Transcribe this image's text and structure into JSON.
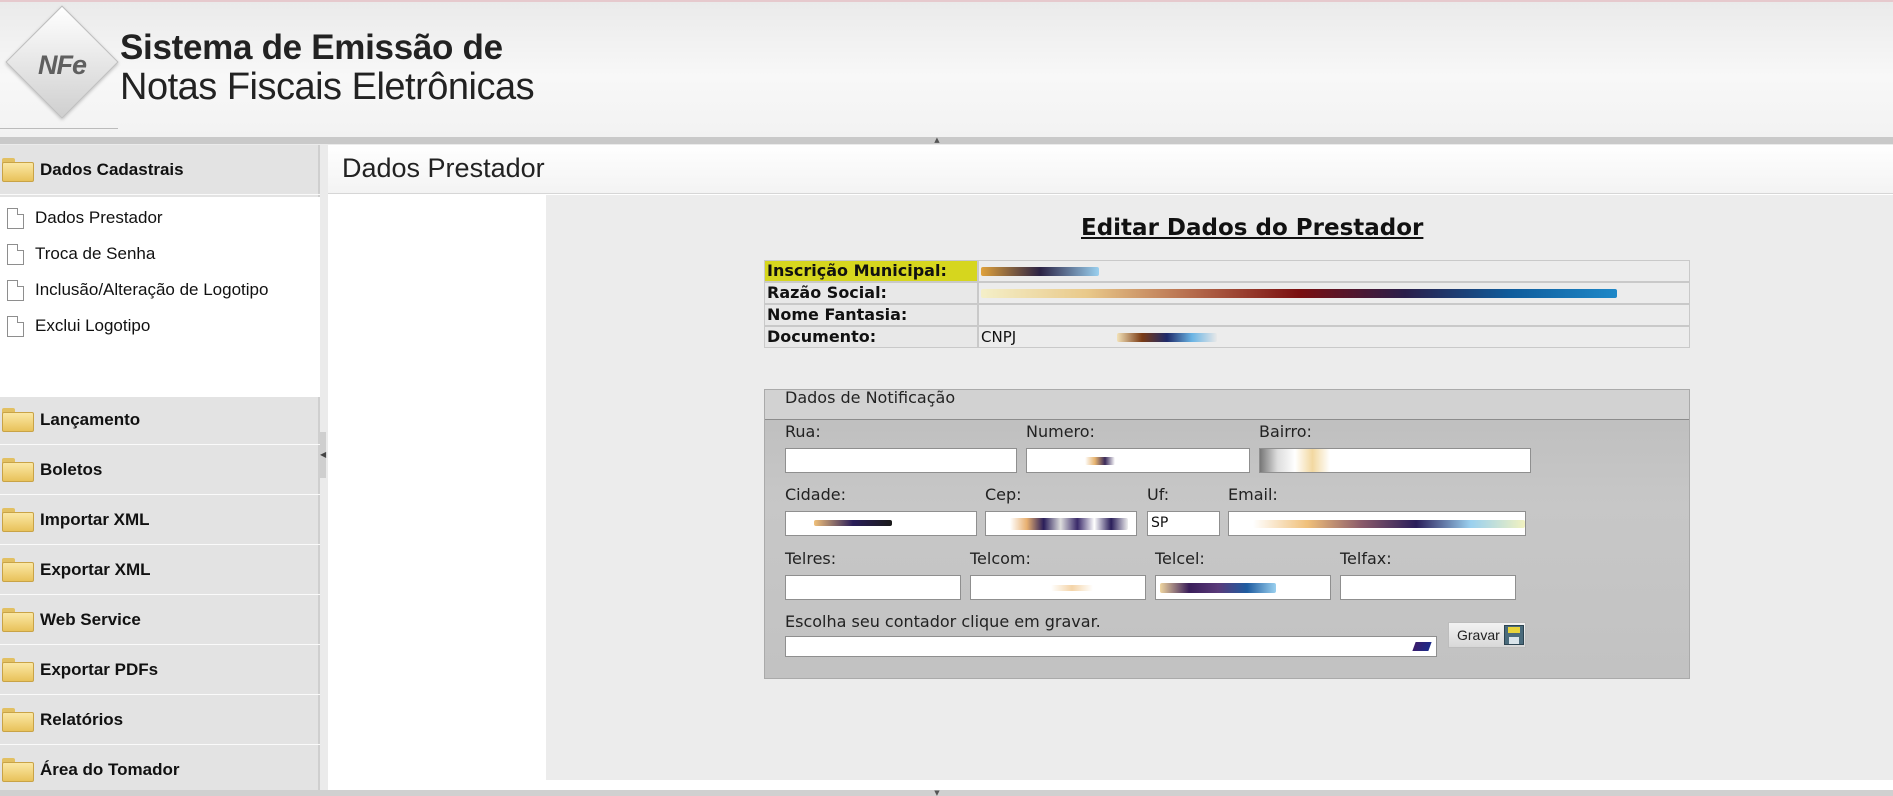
{
  "header": {
    "logo_text": "NFe",
    "title_line1": "Sistema de Emissão de",
    "title_line2": "Notas Fiscais Eletrônicas"
  },
  "sidebar": {
    "expanded_section": {
      "label": "Dados Cadastrais",
      "items": [
        {
          "label": "Dados Prestador"
        },
        {
          "label": "Troca de Senha"
        },
        {
          "label": "Inclusão/Alteração de Logotipo"
        },
        {
          "label": "Exclui Logotipo"
        }
      ]
    },
    "sections": [
      {
        "label": "Lançamento"
      },
      {
        "label": "Boletos"
      },
      {
        "label": "Importar XML"
      },
      {
        "label": "Exportar XML"
      },
      {
        "label": "Web Service"
      },
      {
        "label": "Exportar PDFs"
      },
      {
        "label": "Relatórios"
      },
      {
        "label": "Área do Tomador"
      }
    ]
  },
  "main": {
    "title": "Dados Prestador",
    "form_title": "Editar Dados do Prestador",
    "info": [
      {
        "label": "Inscrição Municipal:",
        "value": ""
      },
      {
        "label": "Razão Social:",
        "value": ""
      },
      {
        "label": "Nome Fantasia:",
        "value": ""
      },
      {
        "label": "Documento:",
        "value": "CNPJ"
      }
    ],
    "notification": {
      "legend": "Dados de Notificação",
      "rua_label": "Rua:",
      "rua_value": "",
      "numero_label": "Numero:",
      "numero_value": "",
      "bairro_label": "Bairro:",
      "bairro_value": "",
      "cidade_label": "Cidade:",
      "cidade_value": "",
      "cep_label": "Cep:",
      "cep_value": "",
      "uf_label": "Uf:",
      "uf_value": "SP",
      "email_label": "Email:",
      "email_value": "",
      "telres_label": "Telres:",
      "telres_value": "",
      "telcom_label": "Telcom:",
      "telcom_value": "",
      "telcel_label": "Telcel:",
      "telcel_value": "",
      "telfax_label": "Telfax:",
      "telfax_value": "",
      "contador_label": "Escolha seu contador clique em gravar.",
      "contador_selected": "",
      "gravar_label": "Gravar"
    }
  },
  "colors": {
    "highlight": "#d6d61e",
    "sidebar_bg": "#e3e3e3",
    "content_bg": "#ececec",
    "fieldset_bg": "#c2c2c2"
  }
}
